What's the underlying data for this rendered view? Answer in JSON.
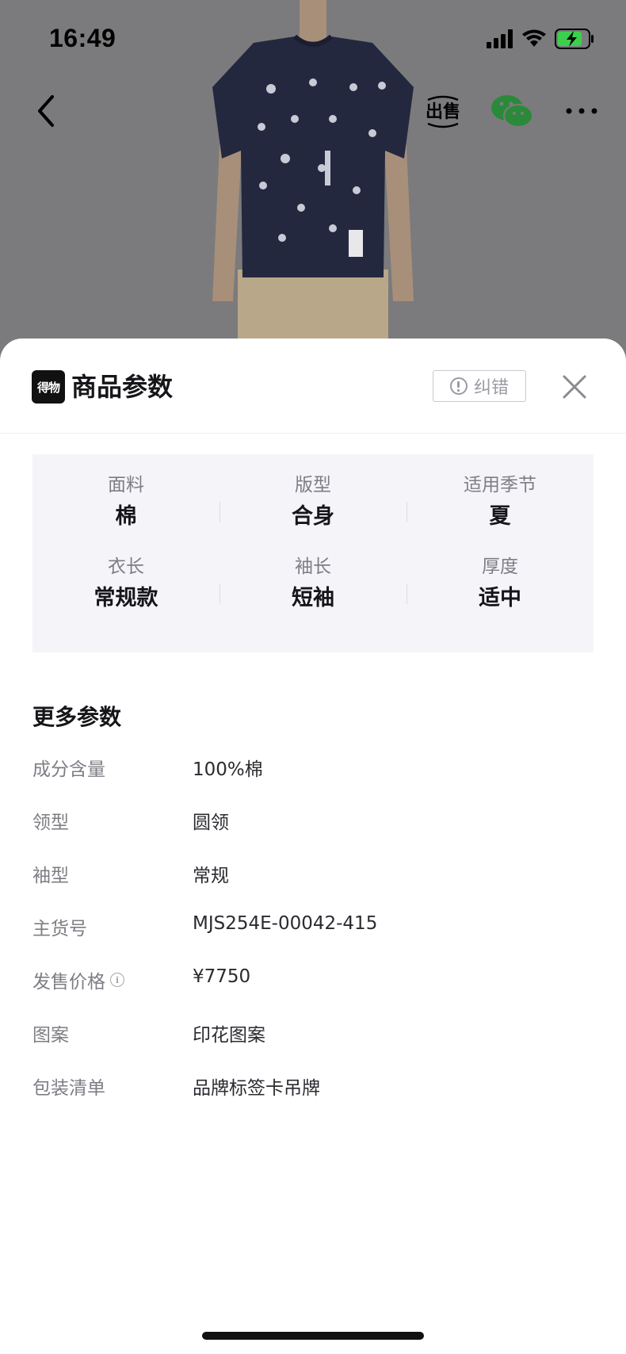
{
  "status_bar": {
    "time": "16:49"
  },
  "nav": {
    "sell_label": "出售"
  },
  "sheet": {
    "brand_logo_text": "得物",
    "title": "商品参数",
    "report_label": "纠错"
  },
  "key_specs": [
    {
      "key": "面料",
      "value": "棉"
    },
    {
      "key": "版型",
      "value": "合身"
    },
    {
      "key": "适用季节",
      "value": "夏"
    },
    {
      "key": "衣长",
      "value": "常规款"
    },
    {
      "key": "袖长",
      "value": "短袖"
    },
    {
      "key": "厚度",
      "value": "适中"
    }
  ],
  "more_params": {
    "title": "更多参数",
    "rows": [
      {
        "key": "成分含量",
        "value": "100%棉"
      },
      {
        "key": "领型",
        "value": "圆领"
      },
      {
        "key": "袖型",
        "value": "常规"
      },
      {
        "key": "主货号",
        "value": "MJS254E-00042-415"
      },
      {
        "key": "发售价格",
        "value": "¥7750"
      },
      {
        "key": "图案",
        "value": "印花图案"
      },
      {
        "key": "包装清单",
        "value": "品牌标签卡吊牌"
      }
    ]
  },
  "colors": {
    "backdrop": "#7b7b7d",
    "shirt": "#23283f",
    "pants": "#b9a789",
    "wechat_green": "#2a8a3a",
    "battery_green": "#3ccf4e"
  }
}
